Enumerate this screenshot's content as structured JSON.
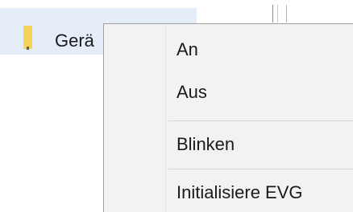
{
  "tree": {
    "label": "Gerä"
  },
  "menu": {
    "items": [
      {
        "label": "An"
      },
      {
        "label": "Aus"
      },
      {
        "label": "Blinken"
      },
      {
        "label": "Initialisiere EVG"
      }
    ]
  }
}
